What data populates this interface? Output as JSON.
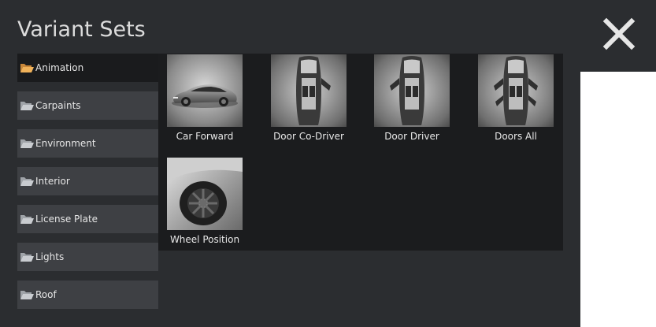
{
  "dialog": {
    "title": "Variant Sets",
    "close_icon": "close-icon"
  },
  "sidebar": {
    "folder_icon": "folder-open-icon",
    "folder_color": "#e8a54a",
    "active_index": 0,
    "items": [
      {
        "label": "Animation"
      },
      {
        "label": "Carpaints"
      },
      {
        "label": "Environment"
      },
      {
        "label": "Interior"
      },
      {
        "label": "License Plate"
      },
      {
        "label": "Lights"
      },
      {
        "label": "Roof"
      }
    ]
  },
  "variants": [
    {
      "label": "Car Forward",
      "image": "car-side-view"
    },
    {
      "label": "Door Co-Driver",
      "image": "car-top-view-passenger-door-open"
    },
    {
      "label": "Door Driver",
      "image": "car-top-view-driver-door-open"
    },
    {
      "label": "Doors All",
      "image": "car-top-view-all-doors-open"
    },
    {
      "label": "Wheel Position",
      "image": "car-wheel-closeup"
    }
  ]
}
